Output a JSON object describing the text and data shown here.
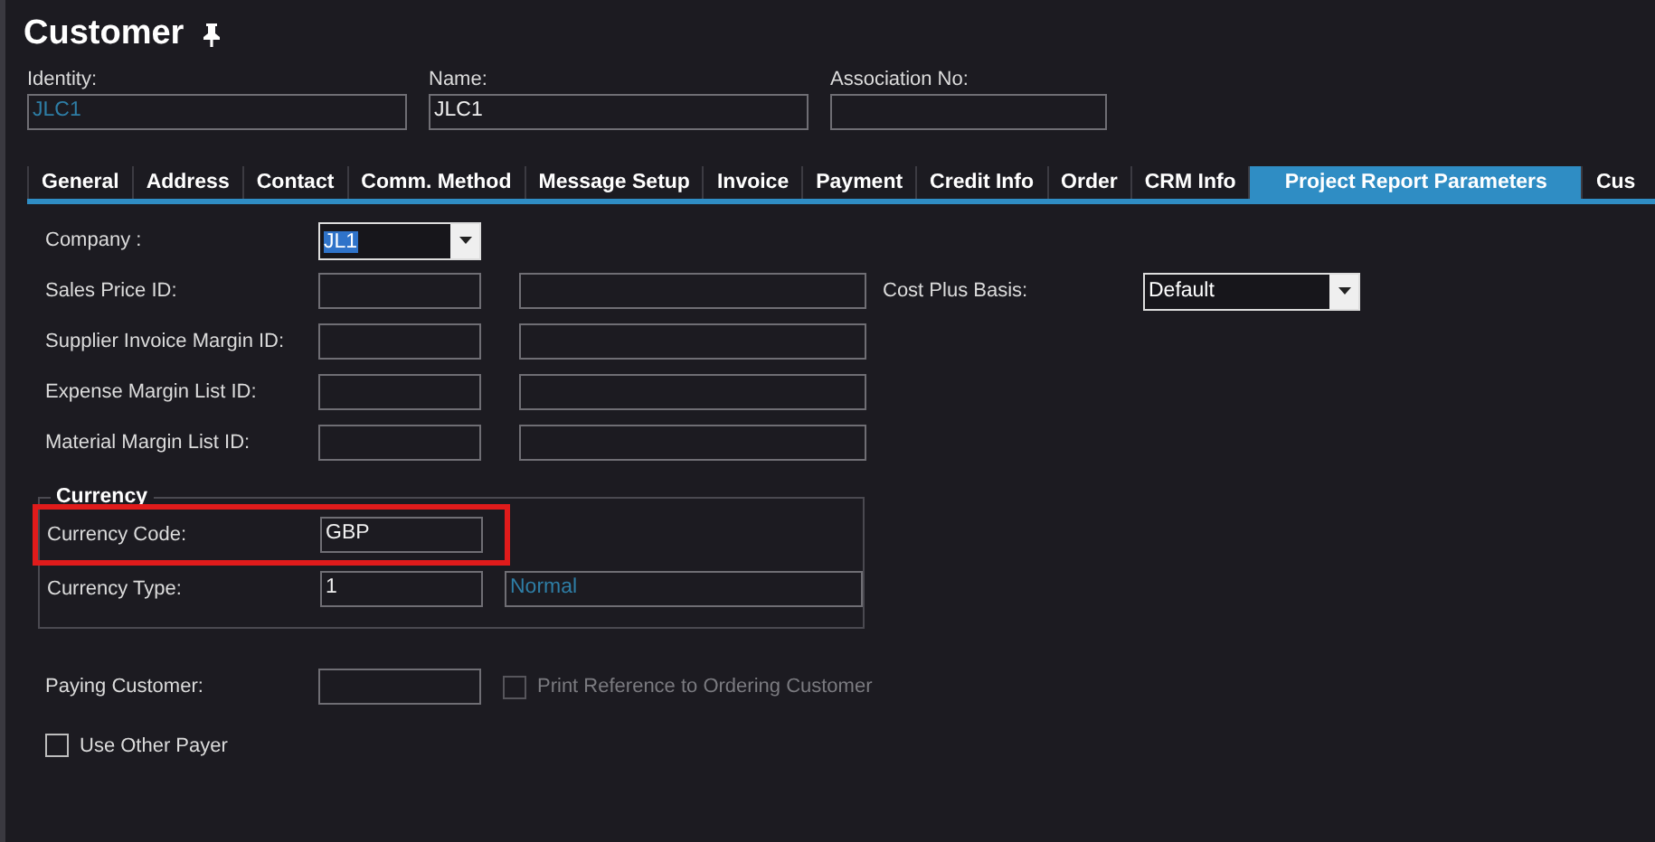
{
  "title": "Customer",
  "header_fields": [
    {
      "label": "Identity:",
      "value": "JLC1",
      "readonly": true
    },
    {
      "label": "Name:",
      "value": "JLC1"
    },
    {
      "label": "Association No:"
    }
  ],
  "tabs": [
    {
      "label": "General",
      "selected": false
    },
    {
      "label": "Address",
      "selected": false
    },
    {
      "label": "Contact",
      "selected": false
    },
    {
      "label": "Comm. Method",
      "selected": false
    },
    {
      "label": "Message Setup",
      "selected": false
    },
    {
      "label": "Invoice",
      "selected": false
    },
    {
      "label": "Payment",
      "selected": false
    },
    {
      "label": "Credit Info",
      "selected": false
    },
    {
      "label": "Order",
      "selected": false
    },
    {
      "label": "CRM Info",
      "selected": false
    },
    {
      "label": "Project Report Parameters",
      "selected": true
    },
    {
      "label": "Cus",
      "selected": false
    }
  ],
  "company": {
    "label": "Company :",
    "value": "JL1"
  },
  "rows": [
    {
      "label": "Sales Price ID:",
      "side": {
        "label": "Cost Plus Basis:",
        "value": "Default"
      }
    },
    {
      "label": "Supplier Invoice Margin ID:"
    },
    {
      "label": "Expense Margin List ID:"
    },
    {
      "label": "Material Margin List ID:"
    }
  ],
  "currency": {
    "title": "Currency",
    "rows": [
      {
        "label": "Currency Code:",
        "value": "GBP",
        "highlighted": true
      },
      {
        "label": "Currency Type:",
        "value": "1",
        "description": "Normal",
        "highlighted": false
      }
    ]
  },
  "paying_customer": {
    "label": "Paying Customer:",
    "option": {
      "label": "Print Reference to Ordering Customer",
      "checked": false,
      "disabled": true
    }
  },
  "use_other_payer": {
    "label": "Use Other Payer",
    "checked": false,
    "disabled": false
  }
}
